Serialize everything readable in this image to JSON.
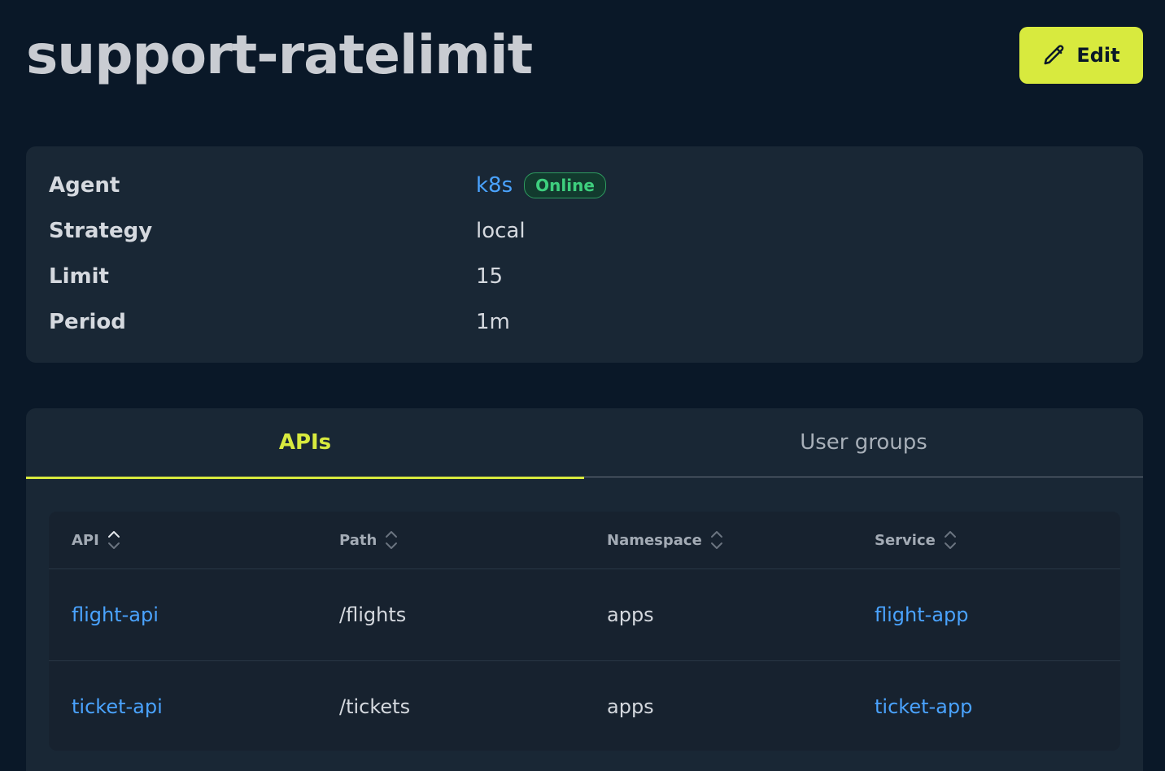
{
  "page": {
    "title": "support-ratelimit",
    "edit_label": "Edit"
  },
  "details": {
    "agent_label": "Agent",
    "agent_value": "k8s",
    "agent_status": "Online",
    "strategy_label": "Strategy",
    "strategy_value": "local",
    "limit_label": "Limit",
    "limit_value": "15",
    "period_label": "Period",
    "period_value": "1m"
  },
  "tabs": [
    {
      "label": "APIs",
      "active": true
    },
    {
      "label": "User groups",
      "active": false
    }
  ],
  "table": {
    "headers": [
      "API",
      "Path",
      "Namespace",
      "Service"
    ],
    "sorted_column": "API",
    "sort_direction": "ascending",
    "rows": [
      {
        "api": "flight-api",
        "path": "/flights",
        "namespace": "apps",
        "service": "flight-app"
      },
      {
        "api": "ticket-api",
        "path": "/tickets",
        "namespace": "apps",
        "service": "ticket-app"
      }
    ]
  },
  "colors": {
    "background": "#0a1828",
    "card": "#192735",
    "accent": "#d8ea3e",
    "link": "#4aa3ff",
    "status_online": "#3ecf7e"
  },
  "icons": {
    "edit": "pencil-icon",
    "sort_active": "sort-ascending-icon",
    "sort_inactive": "sort-icon"
  }
}
